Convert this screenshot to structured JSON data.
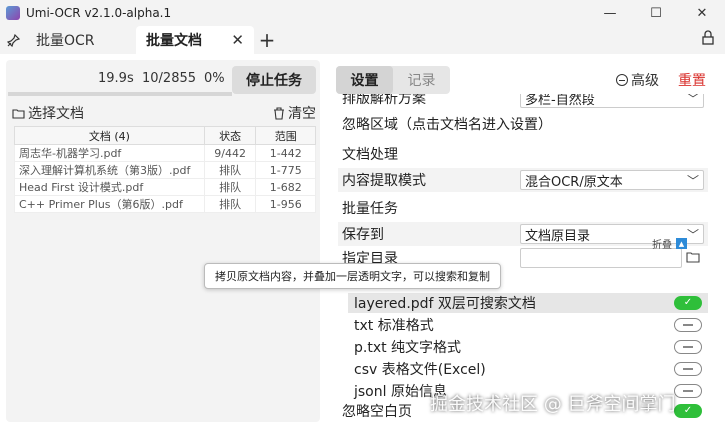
{
  "window": {
    "title": "Umi-OCR v2.1.0-alpha.1",
    "buttons": {
      "minimize": "—",
      "maximize": "☐",
      "close": "✕"
    }
  },
  "tabs": {
    "items": [
      {
        "label": "批量OCR"
      },
      {
        "label": "批量文档",
        "close": "✕"
      }
    ],
    "add": "+"
  },
  "left": {
    "progress": {
      "time": "19.9s",
      "count": "10/2855",
      "percent": "0%",
      "fraction": 0
    },
    "stop_button": "停止任务",
    "select_docs": "选择文档",
    "clear": "清空",
    "table": {
      "headers": [
        "文档 (4)",
        "状态",
        "范围"
      ],
      "rows": [
        [
          "周志华-机器学习.pdf",
          "9/442",
          "1-442"
        ],
        [
          "深入理解计算机系统（第3版）.pdf",
          "排队",
          "1-775"
        ],
        [
          "Head First 设计模式.pdf",
          "排队",
          "1-682"
        ],
        [
          "C++ Primer Plus（第6版）.pdf",
          "排队",
          "1-956"
        ]
      ]
    }
  },
  "right": {
    "tabs": {
      "settings": "设置",
      "records": "记录"
    },
    "advanced": "高级",
    "reset": "重置",
    "settings": {
      "layout_parse": {
        "label": "排版解析方案",
        "value": "多栏-自然段"
      },
      "ignore_area": "忽略区域（点击文档名进入设置）",
      "doc_processing_title": "文档处理",
      "extract_mode": {
        "label": "内容提取模式",
        "value": "混合OCR/原文本"
      },
      "batch_title": "批量任务",
      "save_to": {
        "label": "保存到",
        "value": "文档原目录"
      },
      "target_dir": {
        "label": "指定目录",
        "value": ""
      },
      "fold": "折叠",
      "formats": [
        {
          "label": "layered.pdf 双层可搜索文档",
          "enabled": true
        },
        {
          "label": "txt 标准格式",
          "enabled": false
        },
        {
          "label": "p.txt 纯文字格式",
          "enabled": false
        },
        {
          "label": "csv 表格文件(Excel)",
          "enabled": false
        },
        {
          "label": "jsonl 原始信息",
          "enabled": false
        }
      ],
      "ignore_blank": {
        "label": "忽略空白页",
        "enabled": true
      }
    }
  },
  "tooltip": "拷贝原文档内容，并叠加一层透明文字，可以搜索和复制",
  "watermark": "掘金技术社区 @ 巨斧空间掌门",
  "colors": {
    "accent_blue": "#4a90d9",
    "reset_red": "#d9302c",
    "toggle_on": "#2fbf3a"
  }
}
